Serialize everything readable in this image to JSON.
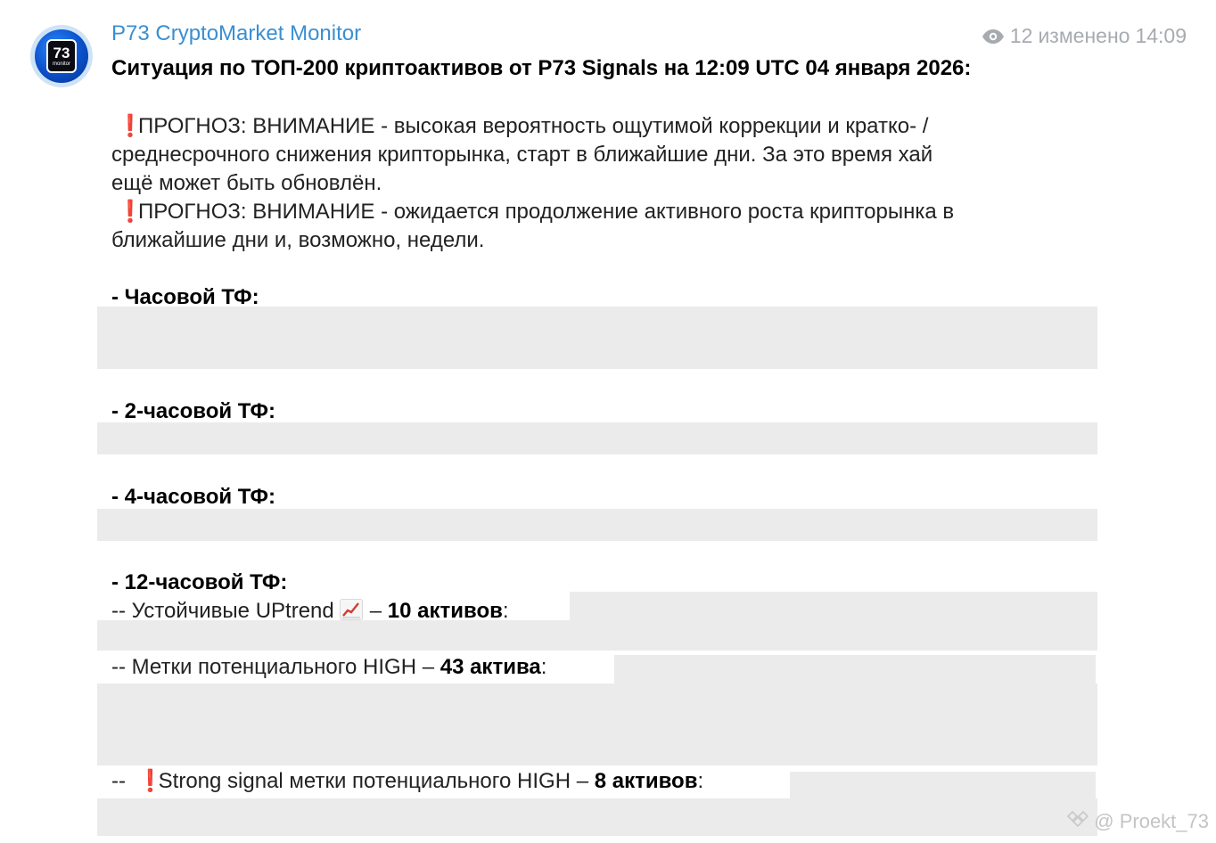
{
  "header": {
    "avatar_number": "73",
    "avatar_sub": "monitor",
    "channel_name": "P73 CryptoMarket Monitor",
    "views": "12",
    "edited_label": "изменено",
    "time": "14:09"
  },
  "message": {
    "title": "Ситуация по ТОП-200 криптоактивов от P73 Signals на 12:09 UTC 04 января 2026:",
    "forecast1": {
      "excl": "❗",
      "line1": "ПРОГНОЗ: ВНИМАНИЕ - высокая вероятность ощутимой коррекции и кратко- /",
      "line2": "среднесрочного снижения крипторынка, старт в ближайшие дни. За это время хай",
      "line3": "ещё может быть обновлён."
    },
    "forecast2": {
      "excl": "❗",
      "line1": "ПРОГНОЗ: ВНИМАНИЕ - ожидается продолжение активного роста крипторынка в",
      "line2": "ближайшие дни и, возможно, недели."
    },
    "tf_1h": "- Часовой ТФ:",
    "tf_2h": "- 2-часовой ТФ:",
    "tf_4h": "- 4-часовой ТФ:",
    "tf_12h": "- 12-часовой ТФ:",
    "uptrend": {
      "prefix": "-- Устойчивые UPtrend",
      "dash": "–",
      "count": "10 активов",
      "colon": ":"
    },
    "high": {
      "prefix": "-- Метки потенциального HIGH –",
      "count": "43 актива",
      "colon": ":"
    },
    "strong": {
      "prefix": "--",
      "excl": "❗",
      "text": "Strong signal метки потенциального HIGH –",
      "count": "8 активов",
      "colon": ":"
    }
  },
  "watermark": "@ Proekt_73",
  "icons": {
    "views": "eye-icon",
    "chart_emoji": "chart-increasing-icon",
    "watermark_logo": "diamond-logo-icon"
  },
  "colors": {
    "channel": "#3a8fd1",
    "meta": "#a7abb0",
    "spoiler": "#ebebeb",
    "exclamation": "#e0302a"
  }
}
